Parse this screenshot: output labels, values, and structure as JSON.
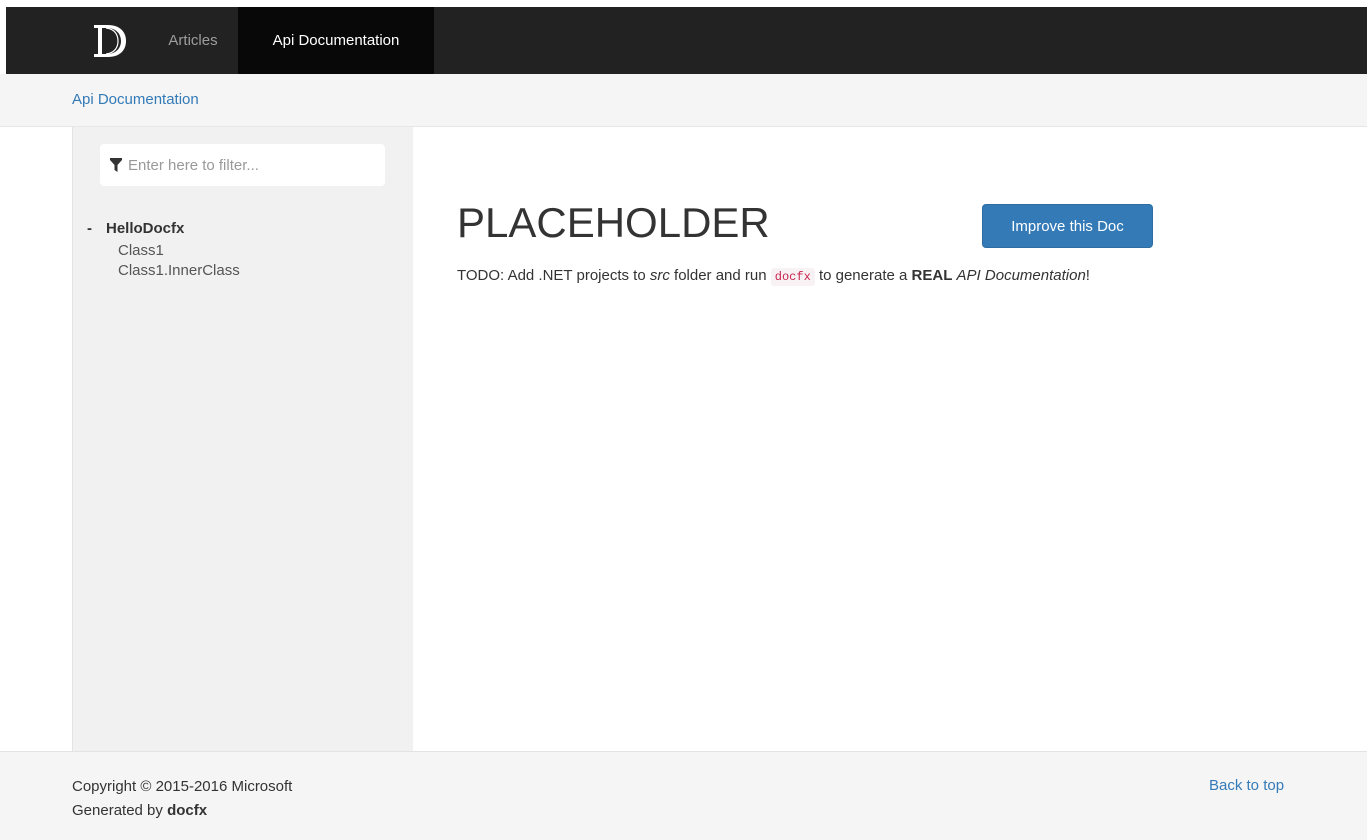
{
  "navbar": {
    "tabs": [
      {
        "label": "Articles",
        "active": false
      },
      {
        "label": "Api Documentation",
        "active": true
      }
    ],
    "brand_icon": "docfx-logo-icon"
  },
  "breadcrumb": {
    "items": [
      "Api Documentation"
    ]
  },
  "sidebar": {
    "filter": {
      "placeholder": "Enter here to filter...",
      "value": "",
      "icon": "filter-icon"
    },
    "toc": {
      "expander": "-",
      "namespace": "HelloDocfx",
      "items": [
        "Class1",
        "Class1.InnerClass"
      ]
    }
  },
  "main": {
    "title": "PLACEHOLDER",
    "improve_button": "Improve this Doc",
    "description": {
      "t1": "TODO: Add .NET projects to ",
      "em1": "src",
      "t2": " folder and run ",
      "code": "docfx",
      "t3": " to generate a ",
      "strong": "REAL",
      "t4": " ",
      "em2": "API Documentation",
      "t5": "!"
    }
  },
  "footer": {
    "copyright": "Copyright © 2015-2016 Microsoft",
    "generated_prefix": "Generated by ",
    "generated_tool": "docfx",
    "back_to_top": "Back to top"
  },
  "colors": {
    "navbar_bg": "#222222",
    "navbar_active_bg": "#080808",
    "link": "#337ab7",
    "button_bg": "#337ab7",
    "sidebar_bg": "#f1f1f1",
    "footer_bg": "#f5f5f5",
    "code_fg": "#c7254e",
    "code_bg": "#f9f2f4"
  }
}
